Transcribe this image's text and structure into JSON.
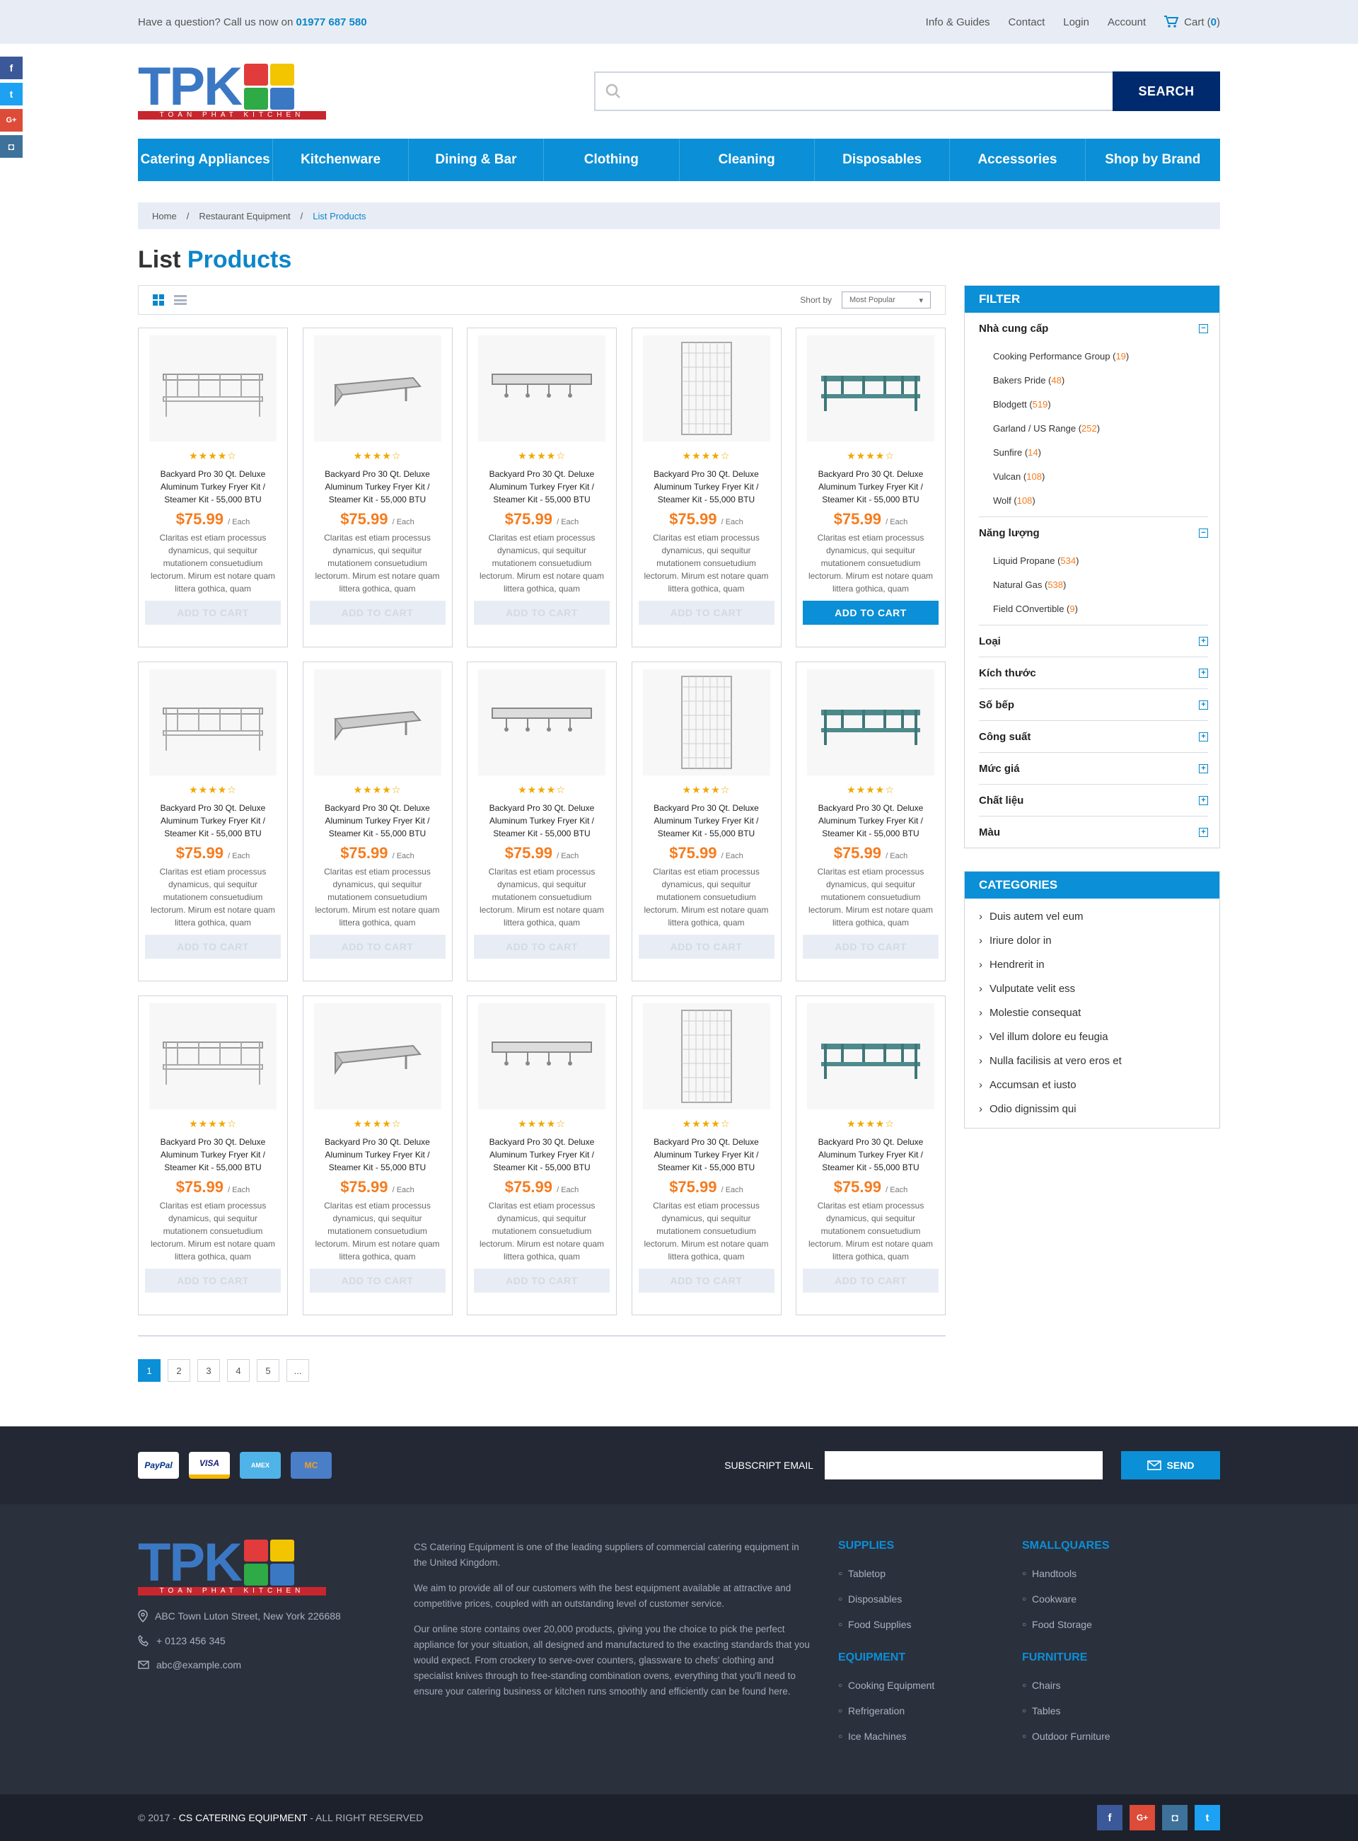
{
  "topbar": {
    "question": "Have a question? Call us now on",
    "phone": "01977 687 580",
    "links": [
      "Info & Guides",
      "Contact",
      "Login",
      "Account"
    ],
    "cart_label": "Cart (",
    "cart_count": "0",
    "cart_close": ")"
  },
  "social_side": [
    "f",
    "t",
    "G+",
    "◘"
  ],
  "logo": {
    "text": "TPK",
    "tagline": "TOAN PHAT KITCHEN"
  },
  "search": {
    "button": "SEARCH",
    "placeholder": ""
  },
  "nav": [
    "Catering Appliances",
    "Kitchenware",
    "Dining & Bar",
    "Clothing",
    "Cleaning",
    "Disposables",
    "Accessories",
    "Shop by Brand"
  ],
  "breadcrumb": [
    "Home",
    "/",
    "Restaurant Equipment",
    "/",
    "List Products"
  ],
  "title": {
    "part1": "List",
    "part2": "Products"
  },
  "toolbar": {
    "sort_label": "Short by",
    "sort_value": "Most Popular"
  },
  "product": {
    "name": "Backyard Pro 30 Qt. Deluxe Aluminum Turkey Fryer Kit / Steamer Kit - 55,000 BTU",
    "price": "$75.99",
    "unit": "/ Each",
    "stars": "★★★★☆",
    "rating": 3.5,
    "desc": "Claritas est etiam processus dynamicus, qui sequitur mutationem consuetudium lectorum. Mirum est notare quam littera gothica, quam",
    "add_label": "ADD TO CART"
  },
  "products_count": 15,
  "active_product_index": 4,
  "pagination": [
    "1",
    "2",
    "3",
    "4",
    "5",
    "..."
  ],
  "filter": {
    "title": "FILTER",
    "groups": [
      {
        "label": "Nhà cung cấp",
        "open": true,
        "items": [
          {
            "name": "Cooking Performance Group",
            "count": "19"
          },
          {
            "name": "Bakers Pride",
            "count": "48"
          },
          {
            "name": "Blodgett",
            "count": "519"
          },
          {
            "name": "Garland / US Range",
            "count": "252"
          },
          {
            "name": "Sunfire",
            "count": "14"
          },
          {
            "name": "Vulcan",
            "count": "108"
          },
          {
            "name": "Wolf",
            "count": "108"
          }
        ]
      },
      {
        "label": "Năng lượng",
        "open": true,
        "items": [
          {
            "name": "Liquid Propane",
            "count": "534"
          },
          {
            "name": "Natural Gas",
            "count": "538"
          },
          {
            "name": "Field COnvertible",
            "count": "9"
          }
        ]
      },
      {
        "label": "Loại",
        "open": false,
        "items": []
      },
      {
        "label": "Kích thước",
        "open": false,
        "items": []
      },
      {
        "label": "Số bếp",
        "open": false,
        "items": []
      },
      {
        "label": "Công suất",
        "open": false,
        "items": []
      },
      {
        "label": "Mức giá",
        "open": false,
        "items": []
      },
      {
        "label": "Chất liệu",
        "open": false,
        "items": []
      },
      {
        "label": "Màu",
        "open": false,
        "items": []
      }
    ]
  },
  "categories": {
    "title": "CATEGORIES",
    "items": [
      "Duis autem vel eum",
      "Iriure dolor in",
      "Hendrerit in",
      "Vulputate velit ess",
      "Molestie consequat",
      "Vel illum dolore eu feugia",
      "Nulla facilisis at vero eros et",
      "Accumsan et iusto",
      "Odio dignissim qui"
    ]
  },
  "footer": {
    "payments": [
      "PayPal",
      "VISA",
      "AMEX",
      "MC"
    ],
    "subscribe_label": "SUBSCRIPT EMAIL",
    "send": "SEND",
    "address": "ABC Town Luton Street, New York 226688",
    "phone": "+ 0123 456 345",
    "email": "abc@example.com",
    "about": [
      "CS Catering Equipment is one of the leading suppliers of commercial catering equipment in the United Kingdom.",
      "We aim to provide all of our customers with the best equipment available at attractive and competitive prices, coupled with an outstanding level of customer service.",
      "Our online store contains over 20,000 products, giving you the choice to pick the perfect appliance for your situation, all designed and manufactured to the exacting standards that you would expect. From crockery to serve-over counters, glassware to chefs' clothing and specialist knives through to free-standing combination ovens, everything that you'll need to ensure your catering business or kitchen runs smoothly and efficiently can be found here."
    ],
    "columns": [
      {
        "title": "SUPPLIES",
        "items": [
          "Tabletop",
          "Disposables",
          "Food Supplies"
        ]
      },
      {
        "title": "SMALLQUARES",
        "items": [
          "Handtools",
          "Cookware",
          "Food Storage"
        ]
      },
      {
        "title": "EQUIPMENT",
        "items": [
          "Cooking Equipment",
          "Refrigeration",
          "Ice Machines"
        ]
      },
      {
        "title": "FURNITURE",
        "items": [
          "Chairs",
          "Tables",
          "Outdoor Furniture"
        ]
      }
    ],
    "copyright_prefix": "© 2017 -",
    "copyright_brand": "CS CATERING EQUIPMENT",
    "copyright_suffix": "- ALL RIGHT RESERVED",
    "social": [
      "f",
      "G+",
      "◘",
      "t"
    ]
  },
  "colors": {
    "primary": "#0b8fd6",
    "navy": "#002a6e",
    "price": "#f57c1f",
    "footer": "#2b303d"
  }
}
